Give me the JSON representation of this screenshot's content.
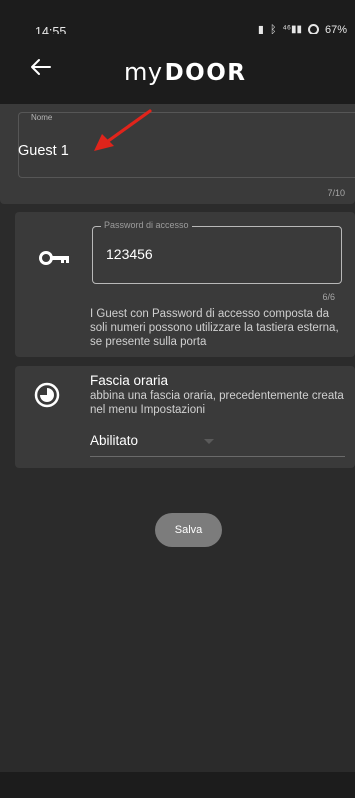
{
  "status_bar": {
    "time": "14:55",
    "signal_text": "⁴⁶",
    "battery_percent": "67%"
  },
  "header": {
    "logo_my": "my",
    "logo_door": "DOOR",
    "back_icon": "arrow-left-icon"
  },
  "name_field": {
    "label": "Nome",
    "value": "Guest 1",
    "counter": "7/10"
  },
  "password_section": {
    "icon": "key-icon",
    "label": "Password di accesso",
    "value": "123456",
    "counter": "6/6",
    "help_text": "I Guest con Password di accesso composta da soli numeri possono utilizzare la tastiera esterna, se presente sulla porta"
  },
  "time_slot_section": {
    "icon": "clock-icon",
    "title": "Fascia oraria",
    "description": "abbina una fascia oraria, precedentemente creata nel menu Impostazioni",
    "selected_option": "Abilitato"
  },
  "save_button": {
    "label": "Salva"
  },
  "colors": {
    "background": "#2b2b2b",
    "header": "#1c1c1c",
    "card": "#3a3a3a",
    "save_button": "#7c7c7c",
    "annotation_arrow": "#e0241b"
  }
}
